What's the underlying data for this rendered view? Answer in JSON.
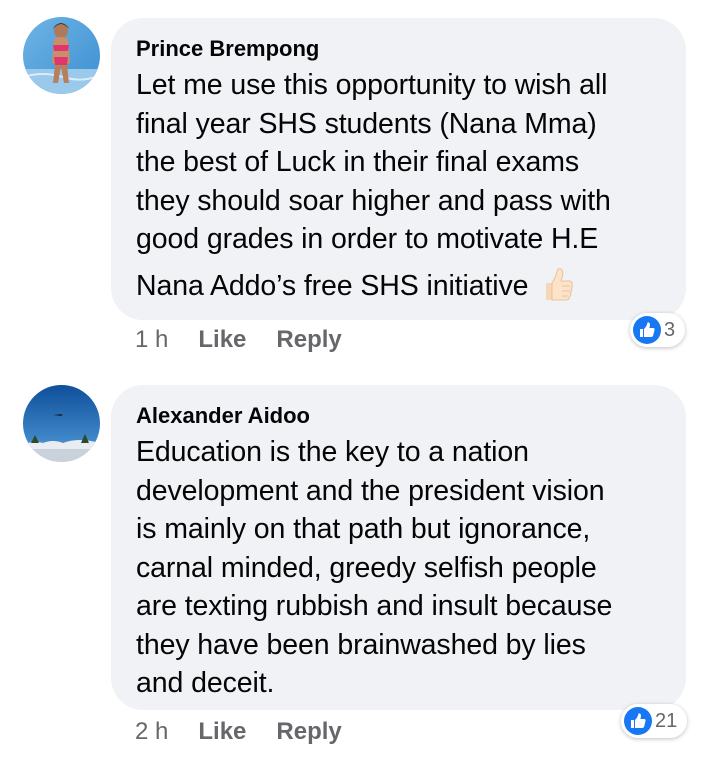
{
  "comments": [
    {
      "author": "Prince Brempong",
      "lines": [
        "Let me use this opportunity to wish all",
        "final year SHS students (Nana Mma)",
        "the best of Luck in their final exams",
        "they should soar higher and pass with",
        "good grades in order to motivate H.E",
        "Nana Addo’s free SHS initiative"
      ],
      "emoji": "thumbs-up-emoji",
      "time": "1 h",
      "like_label": "Like",
      "reply_label": "Reply",
      "reaction_icon": "like-reaction-icon",
      "reaction_count": "3"
    },
    {
      "author": "Alexander Aidoo",
      "lines": [
        "Education is the key to a nation",
        "development and the president vision",
        "is mainly on that path but ignorance,",
        "carnal minded, greedy selfish people",
        "are texting rubbish and insult because",
        "they have been brainwashed by lies",
        "and deceit."
      ],
      "time": "2 h",
      "like_label": "Like",
      "reply_label": "Reply",
      "reaction_icon": "like-reaction-icon",
      "reaction_count": "21"
    }
  ],
  "colors": {
    "bubble": "#f0f2f5",
    "meta_text": "#65676b",
    "like_blue": "#1877f2"
  }
}
